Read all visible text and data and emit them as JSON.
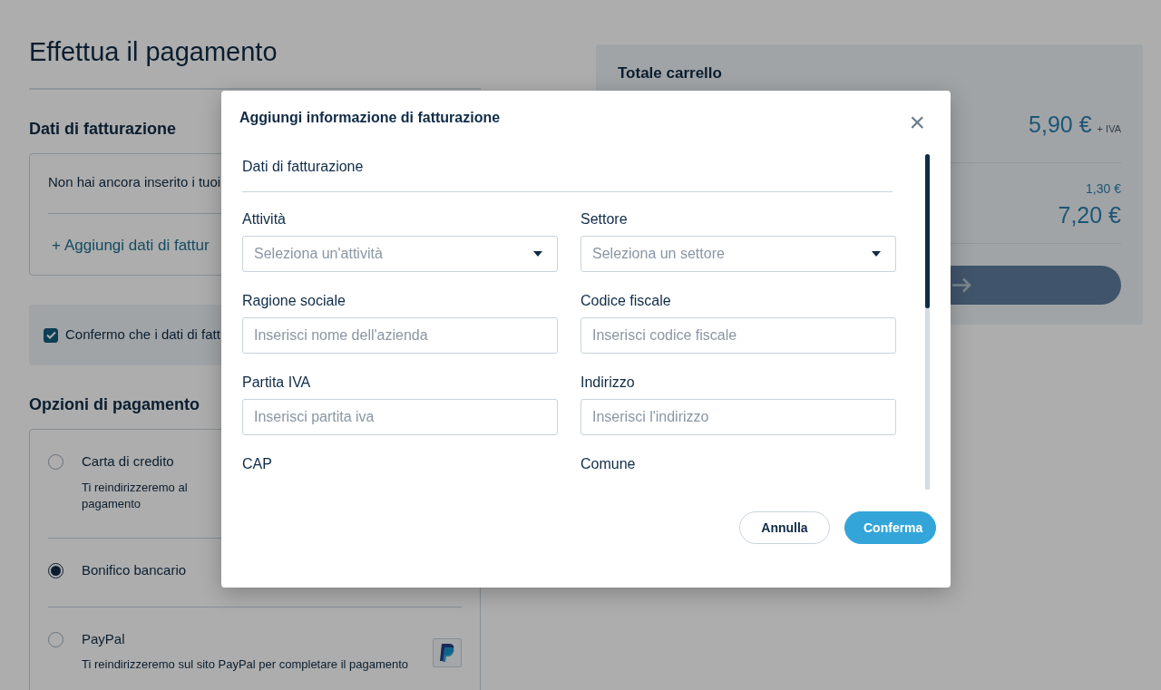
{
  "page": {
    "title": "Effettua il pagamento",
    "billing": {
      "heading": "Dati di fatturazione",
      "notice": "Non hai ancora inserito i tuoi",
      "add_icon": "+",
      "add_link": "Aggiungi dati di fattur"
    },
    "confirm": {
      "label": "Confermo che i dati di fatt",
      "checked": true
    },
    "payment": {
      "heading": "Opzioni di pagamento",
      "options": [
        {
          "label": "Carta di credito",
          "description": "Ti reindirizzeremo al pagamento",
          "selected": false,
          "kind": "narrow"
        },
        {
          "label": "Bonifico bancario",
          "selected": true,
          "kind": "plain"
        },
        {
          "label": "PayPal",
          "description": "Ti reindirizzeremo sul sito PayPal per completare il pagamento",
          "selected": false,
          "kind": "paypal"
        }
      ]
    }
  },
  "cart": {
    "title": "Totale carrello",
    "amount": "5,90 €",
    "amount_suffix": "+ IVA",
    "rows": [
      {
        "value": "1,30 €",
        "kind": "small"
      },
      {
        "value": "7,20 €",
        "kind": "total"
      }
    ]
  },
  "modal": {
    "title": "Aggiungi informazione di fatturazione",
    "close": "×",
    "section": "Dati di fatturazione",
    "fields": [
      {
        "label": "Attività",
        "kind": "select",
        "placeholder": "Seleziona un'attività"
      },
      {
        "label": "Settore",
        "kind": "select",
        "placeholder": "Seleziona un settore"
      },
      {
        "label": "Ragione sociale",
        "kind": "input",
        "placeholder": "Inserisci nome dell'azienda"
      },
      {
        "label": "Codice fiscale",
        "kind": "input",
        "placeholder": "Inserisci codice fiscale"
      },
      {
        "label": "Partita IVA",
        "kind": "input",
        "placeholder": "Inserisci partita iva"
      },
      {
        "label": "Indirizzo",
        "kind": "input",
        "placeholder": "Inserisci l'indirizzo"
      },
      {
        "label": "CAP",
        "kind": "cut"
      },
      {
        "label": "Comune",
        "kind": "cut"
      }
    ],
    "buttons": [
      {
        "label": "Annulla",
        "kind": "secondary"
      },
      {
        "label": "Conferma",
        "kind": "primary"
      }
    ]
  }
}
